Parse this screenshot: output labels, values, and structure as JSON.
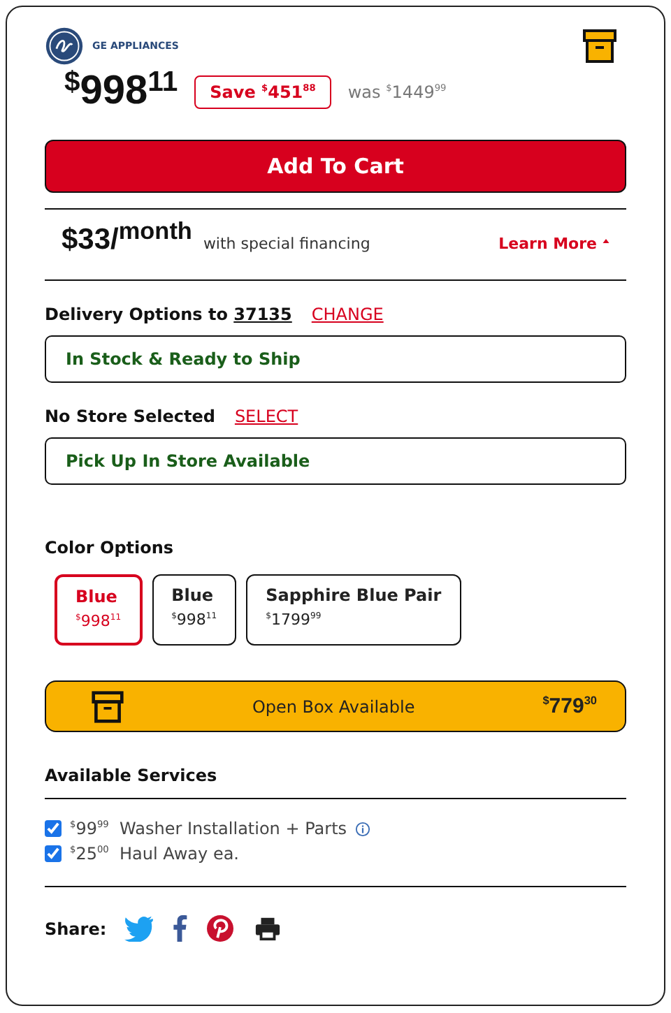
{
  "brand": {
    "name": "GE APPLIANCES"
  },
  "price": {
    "currency": "$",
    "dollars": "998",
    "cents": "11"
  },
  "savings": {
    "label": "Save",
    "currency": "$",
    "dollars": "451",
    "cents": "88"
  },
  "was": {
    "label": "was",
    "currency": "$",
    "dollars": "1449",
    "cents": "99"
  },
  "add_to_cart": "Add To Cart",
  "financing": {
    "amount": "$33/",
    "period": "month",
    "note": "with special financing",
    "link": "Learn More",
    "expanded": true
  },
  "delivery": {
    "label": "Delivery Options to",
    "zip": "37135",
    "action": "CHANGE",
    "status": "In Stock & Ready to Ship"
  },
  "store": {
    "label": "No Store Selected",
    "action": "SELECT",
    "status": "Pick Up In Store Available"
  },
  "color_options": {
    "title": "Color Options",
    "options": [
      {
        "name": "Blue",
        "currency": "$",
        "dollars": "998",
        "cents": "11",
        "selected": true
      },
      {
        "name": "Blue",
        "currency": "$",
        "dollars": "998",
        "cents": "11",
        "selected": false
      },
      {
        "name": "Sapphire Blue Pair",
        "currency": "$",
        "dollars": "1799",
        "cents": "99",
        "selected": false
      }
    ]
  },
  "open_box": {
    "label": "Open Box Available",
    "currency": "$",
    "dollars": "779",
    "cents": "30"
  },
  "services": {
    "title": "Available Services",
    "items": [
      {
        "currency": "$",
        "dollars": "99",
        "cents": "99",
        "name": "Washer Installation + Parts",
        "checked": true,
        "info": true
      },
      {
        "currency": "$",
        "dollars": "25",
        "cents": "00",
        "name": "Haul Away ea.",
        "checked": true,
        "info": false
      }
    ]
  },
  "share": {
    "label": "Share:"
  }
}
